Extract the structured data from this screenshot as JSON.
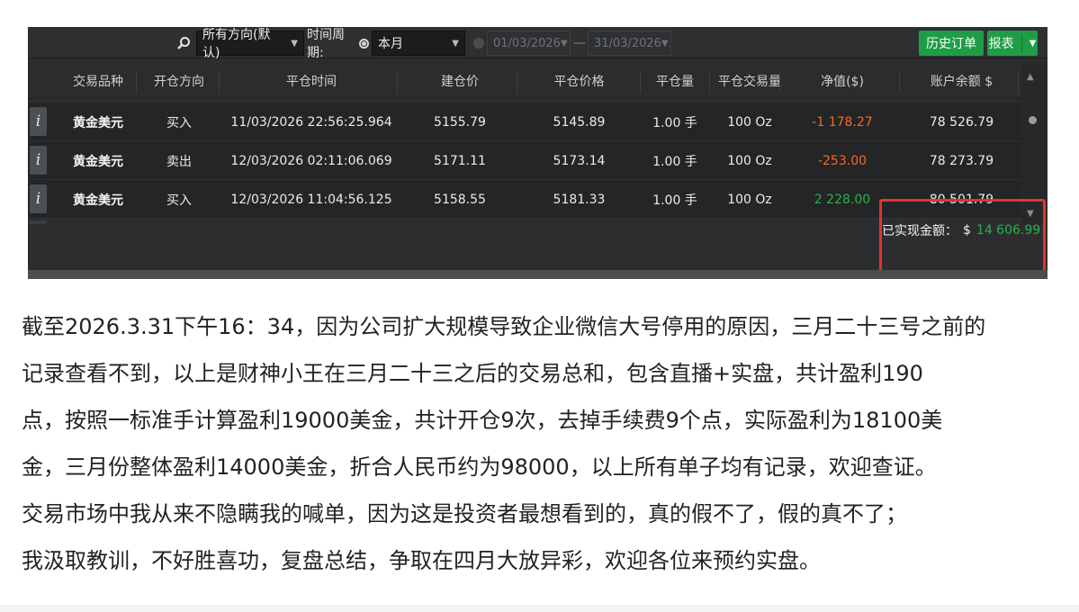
{
  "toolbar": {
    "direction_value": "所有方向(默认)",
    "period_label": "时间周期:",
    "period_value": "本月",
    "date_from": "01/03/2026",
    "date_to": "31/03/2026",
    "history_button": "历史订单",
    "report_button": "报表"
  },
  "table": {
    "columns": [
      "交易品种",
      "开仓方向",
      "平仓时间",
      "建仓价",
      "平仓价格",
      "平仓量",
      "平仓交易量",
      "净值($)",
      "账户余额 $"
    ],
    "rows": [
      {
        "info": "i",
        "symbol": "黄金美元",
        "direction": "买入",
        "close_time": "11/03/2026 22:56:25.964",
        "open_price": "5155.79",
        "close_price": "5145.89",
        "lots": "1.00 手",
        "volume": "100 Oz",
        "net": "-1 178.27",
        "net_sign": "neg",
        "balance": "78 526.79"
      },
      {
        "info": "i",
        "symbol": "黄金美元",
        "direction": "卖出",
        "close_time": "12/03/2026 02:11:06.069",
        "open_price": "5171.11",
        "close_price": "5173.14",
        "lots": "1.00 手",
        "volume": "100 Oz",
        "net": "-253.00",
        "net_sign": "neg",
        "balance": "78 273.79"
      },
      {
        "info": "i",
        "symbol": "黄金美元",
        "direction": "买入",
        "close_time": "12/03/2026 11:04:56.125",
        "open_price": "5158.55",
        "close_price": "5181.33",
        "lots": "1.00 手",
        "volume": "100 Oz",
        "net": "2 228.00",
        "net_sign": "pos",
        "balance": "80 501.79"
      }
    ]
  },
  "summary": {
    "label": "已实现金额：",
    "currency": "$",
    "amount": "14 606.99"
  },
  "article": {
    "lines": [
      "截至2026.3.31下午16：34，因为公司扩大规模导致企业微信大号停用的原因，三月二十三号之前的",
      "记录查看不到，以上是财神小王在三月二十三之后的交易总和，包含直播+实盘，共计盈利190",
      "点，按照一标准手计算盈利19000美金，共计开仓9次，去掉手续费9个点，实际盈利为18100美",
      "金，三月份整体盈利14000美金，折合人民币约为98000，以上所有单子均有记录，欢迎查证。",
      "交易市场中我从来不隐瞒我的喊单，因为这是投资者最想看到的，真的假不了，假的真不了；",
      "我汲取教训，不好胜喜功，复盘总结，争取在四月大放异彩，欢迎各位来预约实盘。"
    ]
  },
  "colors": {
    "positive": "#27b34a",
    "negative": "#f26a27",
    "highlight": "#e5322d",
    "button": "#1f9d46"
  }
}
